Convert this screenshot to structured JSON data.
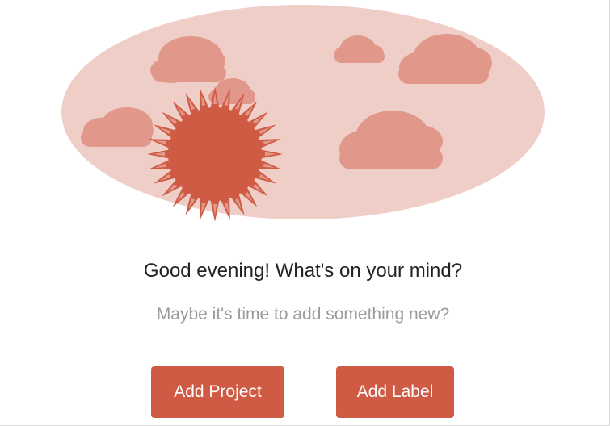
{
  "empty_state": {
    "greeting": "Good evening! What's on your mind?",
    "subtext": "Maybe it's time to add something new?"
  },
  "actions": {
    "add_project_label": "Add Project",
    "add_label_label": "Add Label"
  },
  "colors": {
    "accent": "#cf5b44",
    "sky": "#efcec8",
    "cloud": "#e1988a",
    "sun": "#cf5b44"
  },
  "illustration": {
    "icon": "evening-sun-clouds-illustration"
  }
}
